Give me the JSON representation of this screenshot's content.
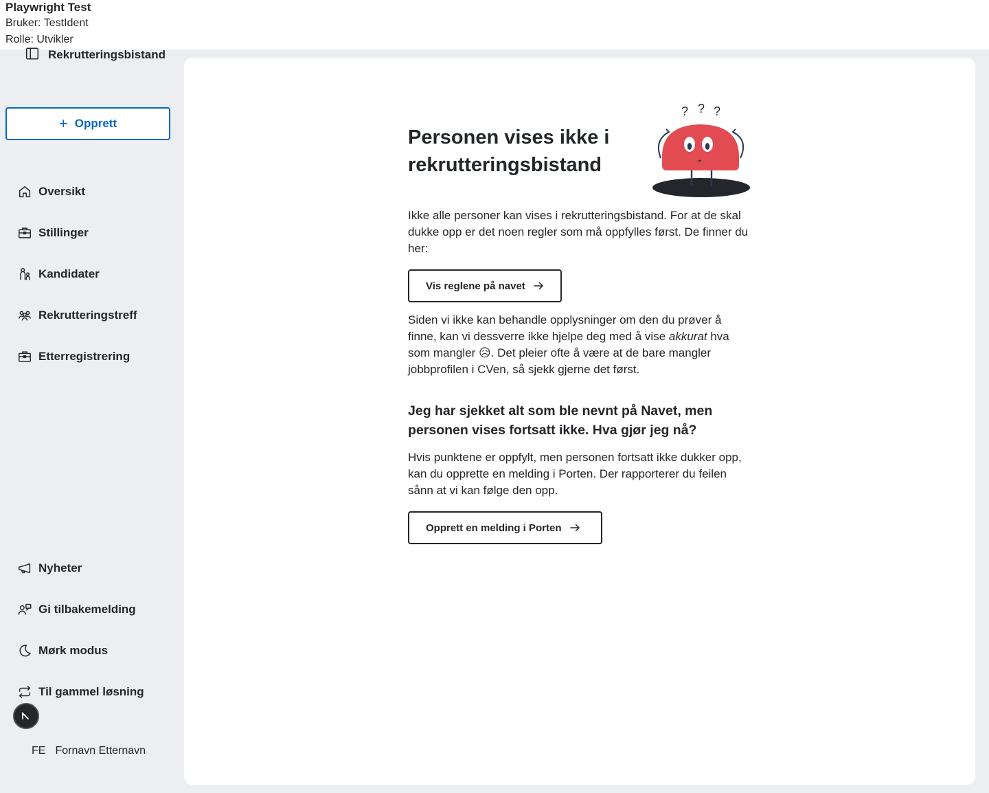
{
  "topbar": {
    "app_name": "Playwright Test",
    "user_line": "Bruker: TestIdent",
    "role_line": "Rolle: Utvikler"
  },
  "sidebar": {
    "brand": "Rekrutteringsbistand",
    "create_label": "Opprett",
    "nav": [
      {
        "label": "Oversikt",
        "icon": "house-icon"
      },
      {
        "label": "Stillinger",
        "icon": "briefcase-icon"
      },
      {
        "label": "Kandidater",
        "icon": "person-child-icon"
      },
      {
        "label": "Rekrutteringstreff",
        "icon": "people-group-icon"
      },
      {
        "label": "Etterregistrering",
        "icon": "briefcase-icon"
      }
    ],
    "bottom_nav": [
      {
        "label": "Nyheter",
        "icon": "megaphone-icon"
      },
      {
        "label": "Gi tilbakemelding",
        "icon": "person-chat-icon"
      },
      {
        "label": "Mørk modus",
        "icon": "moon-icon"
      },
      {
        "label": "Til gammel løsning",
        "icon": "arrows-cycle-icon"
      }
    ],
    "user": {
      "initials": "FE",
      "name": "Fornavn Etternavn"
    }
  },
  "main": {
    "heading": "Personen vises ikke i rekrutteringsbistand",
    "intro": "Ikke alle personer kan vises i rekrutteringsbistand. For at de skal dukke opp er det noen regler som må oppfylles først. De finner du her:",
    "rules_button": "Vis reglene på navet",
    "explain_before": "Siden vi ikke kan behandle opplysninger om den du prøver å finne, kan vi dessverre ikke hjelpe deg med å vise ",
    "explain_em": "akkurat",
    "explain_after": " hva som mangler 😥. Det pleier ofte å være at de bare mangler jobbprofilen i CVen, så sjekk gjerne det først.",
    "subheading": "Jeg har sjekket alt som ble nevnt på Navet, men personen vises fortsatt ikke. Hva gjør jeg nå?",
    "porten_text": "Hvis punktene er oppfylt, men personen fortsatt ikke dukker opp, kan du opprette en melding i Porten. Der rapporterer du feilen sånn at vi kan følge den opp.",
    "porten_button": "Opprett en melding i Porten",
    "illustration_question_marks": [
      "?",
      "?",
      "?"
    ]
  },
  "colors": {
    "accent": "#0067c5",
    "sidebar_bg": "#eceef1",
    "text": "#23262a",
    "illustration_red": "#e34b52"
  }
}
